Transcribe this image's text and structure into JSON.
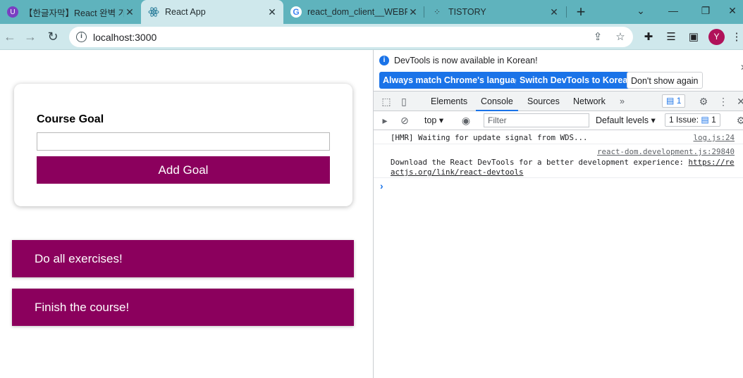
{
  "browser": {
    "tabs": [
      {
        "title": "【한글자막】React 완벽 가",
        "icon": "udemy-icon"
      },
      {
        "title": "React App",
        "icon": "react-icon"
      },
      {
        "title": "react_dom_client__WEBPACK",
        "icon": "google-icon"
      },
      {
        "title": "TISTORY",
        "icon": "tistory-icon"
      }
    ],
    "url": "localhost:3000",
    "avatar_letter": "Y"
  },
  "app": {
    "form_label": "Course Goal",
    "input_value": "",
    "add_button": "Add Goal",
    "goals": [
      "Do all exercises!",
      "Finish the course!"
    ],
    "accent_color": "#8b005d"
  },
  "devtools": {
    "infobar_message": "DevTools is now available in Korean!",
    "btn_match": "Always match Chrome's language",
    "btn_switch": "Switch DevTools to Korean",
    "btn_dont_show": "Don't show again",
    "tabs": [
      "Elements",
      "Console",
      "Sources",
      "Network"
    ],
    "selected_tab": "Console",
    "messages_badge": "1",
    "context": "top",
    "filter_placeholder": "Filter",
    "levels": "Default levels",
    "issues": "1 Issue:",
    "issues_count": "1",
    "logs": [
      {
        "text": "[HMR] Waiting for update signal from WDS...",
        "source": "log.js:24"
      },
      {
        "text": "Download the React DevTools for a better development experience:",
        "link": "https://reactjs.org/link/react-devtools",
        "source": "react-dom.development.js:29840"
      }
    ]
  }
}
